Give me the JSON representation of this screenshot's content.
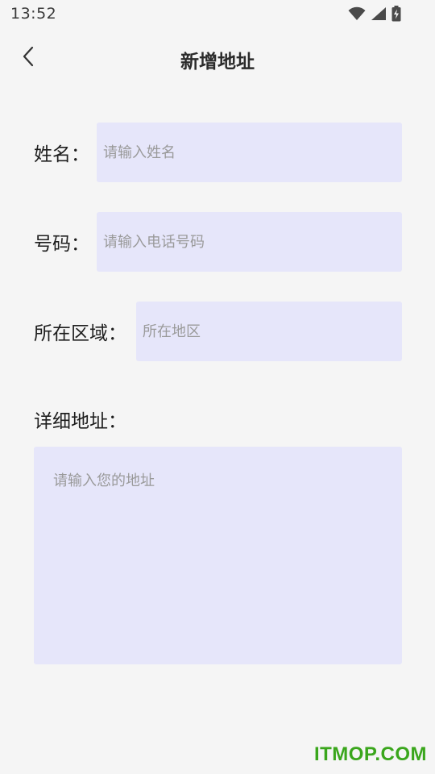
{
  "status_bar": {
    "time": "13:52",
    "icons": [
      "wifi-icon",
      "cellular-signal-icon",
      "battery-charging-icon"
    ]
  },
  "header": {
    "back_icon": "chevron-left-icon",
    "title": "新增地址"
  },
  "form": {
    "name": {
      "label": "姓名：",
      "value": "",
      "placeholder": "请输入姓名"
    },
    "phone": {
      "label": "号码：",
      "value": "",
      "placeholder": "请输入电话号码"
    },
    "region": {
      "label": "所在区域：",
      "value": "",
      "placeholder": "所在地区"
    },
    "detail": {
      "label": "详细地址：",
      "value": "",
      "placeholder": "请输入您的地址"
    }
  },
  "colors": {
    "background": "#f5f5f5",
    "input_fill": "#e6e6fa",
    "watermark": "#3aa61c"
  },
  "watermark": "ITMOP.COM"
}
